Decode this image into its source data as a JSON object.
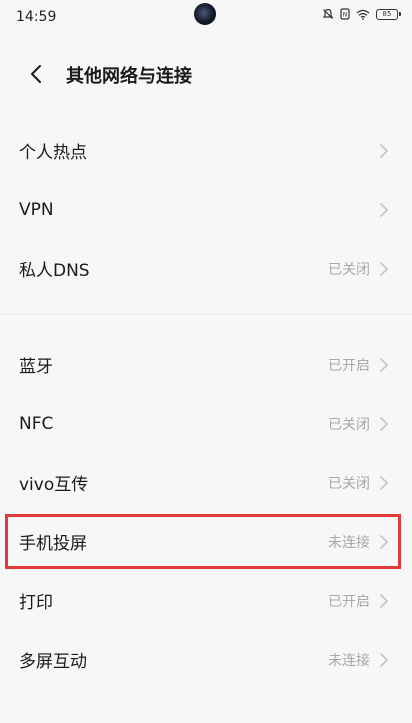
{
  "status_bar": {
    "time": "14:59",
    "battery": "85"
  },
  "header": {
    "title": "其他网络与连接"
  },
  "group1": [
    {
      "label": "个人热点",
      "status": ""
    },
    {
      "label": "VPN",
      "status": ""
    },
    {
      "label": "私人DNS",
      "status": "已关闭"
    }
  ],
  "group2": [
    {
      "label": "蓝牙",
      "status": "已开启"
    },
    {
      "label": "NFC",
      "status": "已关闭"
    },
    {
      "label": "vivo互传",
      "status": "已关闭"
    },
    {
      "label": "手机投屏",
      "status": "未连接"
    },
    {
      "label": "打印",
      "status": "已开启"
    },
    {
      "label": "多屏互动",
      "status": "未连接"
    }
  ],
  "colors": {
    "highlight_border": "#e03a3a",
    "status_text": "#a8a8a8"
  }
}
